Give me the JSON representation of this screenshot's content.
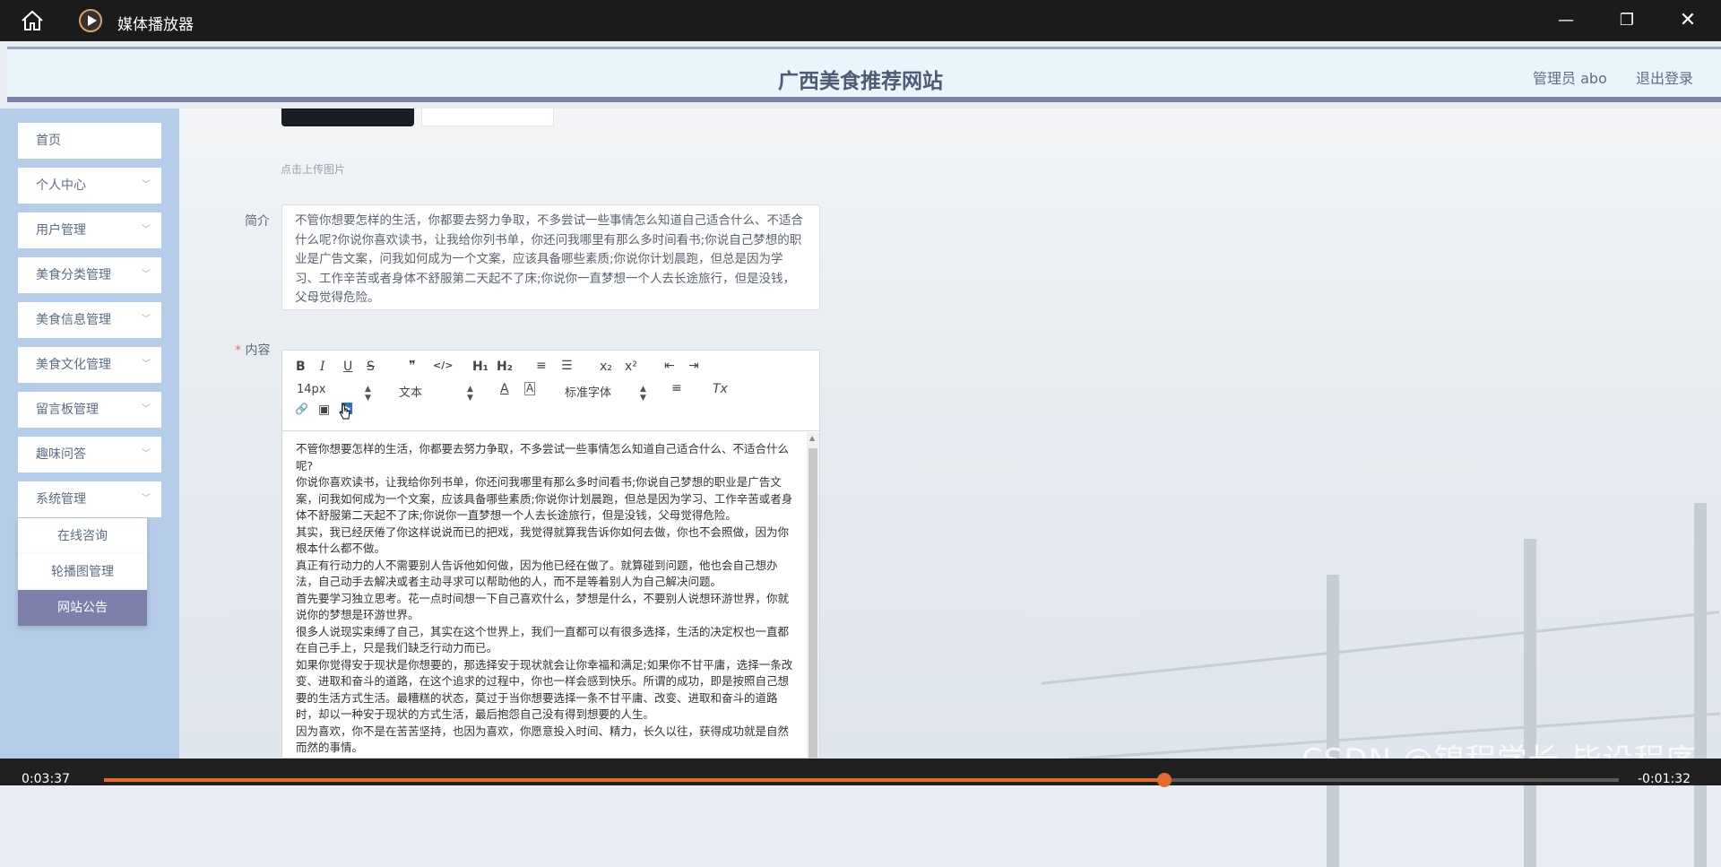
{
  "player": {
    "title": "媒体播放器",
    "minimize": "—",
    "maximize": "❐",
    "close": "✕",
    "current_time": "0:03:37",
    "remaining_time": "-0:01:32",
    "progress": 0.7
  },
  "header": {
    "site_title": "广西美食推荐网站",
    "admin_label": "管理员 abo",
    "logout": "退出登录"
  },
  "sidebar": {
    "items": [
      {
        "label": "首页"
      },
      {
        "label": "个人中心"
      },
      {
        "label": "用户管理"
      },
      {
        "label": "美食分类管理"
      },
      {
        "label": "美食信息管理"
      },
      {
        "label": "美食文化管理"
      },
      {
        "label": "留言板管理"
      },
      {
        "label": "趣味问答"
      },
      {
        "label": "系统管理"
      }
    ],
    "chevron": "﹀",
    "submenu": [
      {
        "label": "在线咨询"
      },
      {
        "label": "轮播图管理"
      },
      {
        "label": "网站公告"
      }
    ]
  },
  "form": {
    "upload_tip": "点击上传图片",
    "intro_label": "简介",
    "intro_value": "不管你想要怎样的生活，你都要去努力争取，不多尝试一些事情怎么知道自己适合什么、不适合什么呢?你说你喜欢读书，让我给你列书单，你还问我哪里有那么多时间看书;你说自己梦想的职业是广告文案，问我如何成为一个文案，应该具备哪些素质;你说你计划晨跑，但总是因为学习、工作辛苦或者身体不舒服第二天起不了床;你说你一直梦想一个人去长途旅行，但是没钱，父母觉得危险。",
    "content_label": "内容",
    "required_mark": "*"
  },
  "editor": {
    "toolbar": {
      "bold": "B",
      "italic": "I",
      "underline": "U",
      "strike": "S",
      "blockquote": "❞",
      "code": "</>",
      "h1": "H₁",
      "h2": "H₂",
      "ordered_list": "≡",
      "bullet_list": "☰",
      "subscript": "x₂",
      "superscript": "x²",
      "outdent": "⇤",
      "indent": "⇥",
      "font_size": "14px",
      "text_style": "文本",
      "color": "A",
      "background": "A",
      "font_family": "标准字体",
      "align": "≡",
      "clean": "Tx",
      "link": "🔗",
      "image": "▣",
      "video": "▶"
    },
    "paragraphs": [
      "不管你想要怎样的生活，你都要去努力争取，不多尝试一些事情怎么知道自己适合什么、不适合什么呢?",
      "你说你喜欢读书，让我给你列书单，你还问我哪里有那么多时间看书;你说自己梦想的职业是广告文案，问我如何成为一个文案，应该具备哪些素质;你说你计划晨跑，但总是因为学习、工作辛苦或者身体不舒服第二天起不了床;你说你一直梦想一个人去长途旅行，但是没钱，父母觉得危险。",
      "其实，我已经厌倦了你这样说说而已的把戏，我觉得就算我告诉你如何去做，你也不会照做，因为你根本什么都不做。",
      "真正有行动力的人不需要别人告诉他如何做，因为他已经在做了。就算碰到问题，他也会自己想办法，自己动手去解决或者主动寻求可以帮助他的人，而不是等着别人为自己解决问题。",
      "首先要学习独立思考。花一点时间想一下自己喜欢什么，梦想是什么，不要别人说想环游世界，你就说你的梦想是环游世界。",
      "很多人说现实束缚了自己，其实在这个世界上，我们一直都可以有很多选择，生活的决定权也一直都在自己手上，只是我们缺乏行动力而已。",
      "如果你觉得安于现状是你想要的，那选择安于现状就会让你幸福和满足;如果你不甘平庸，选择一条改变、进取和奋斗的道路，在这个追求的过程中，你也一样会感到快乐。所谓的成功，即是按照自己想要的生活方式生活。最糟糕的状态，莫过于当你想要选择一条不甘平庸、改变、进取和奋斗的道路时，却以一种安于现状的方式生活，最后抱怨自己没有得到想要的人生。",
      "因为喜欢，你不是在苦苦坚持，也因为喜欢，你愿意投入时间、精力，长久以往，获得成功就是自然而然的事情。"
    ]
  },
  "watermark": "CSDN @锦程学长-毕设程序"
}
